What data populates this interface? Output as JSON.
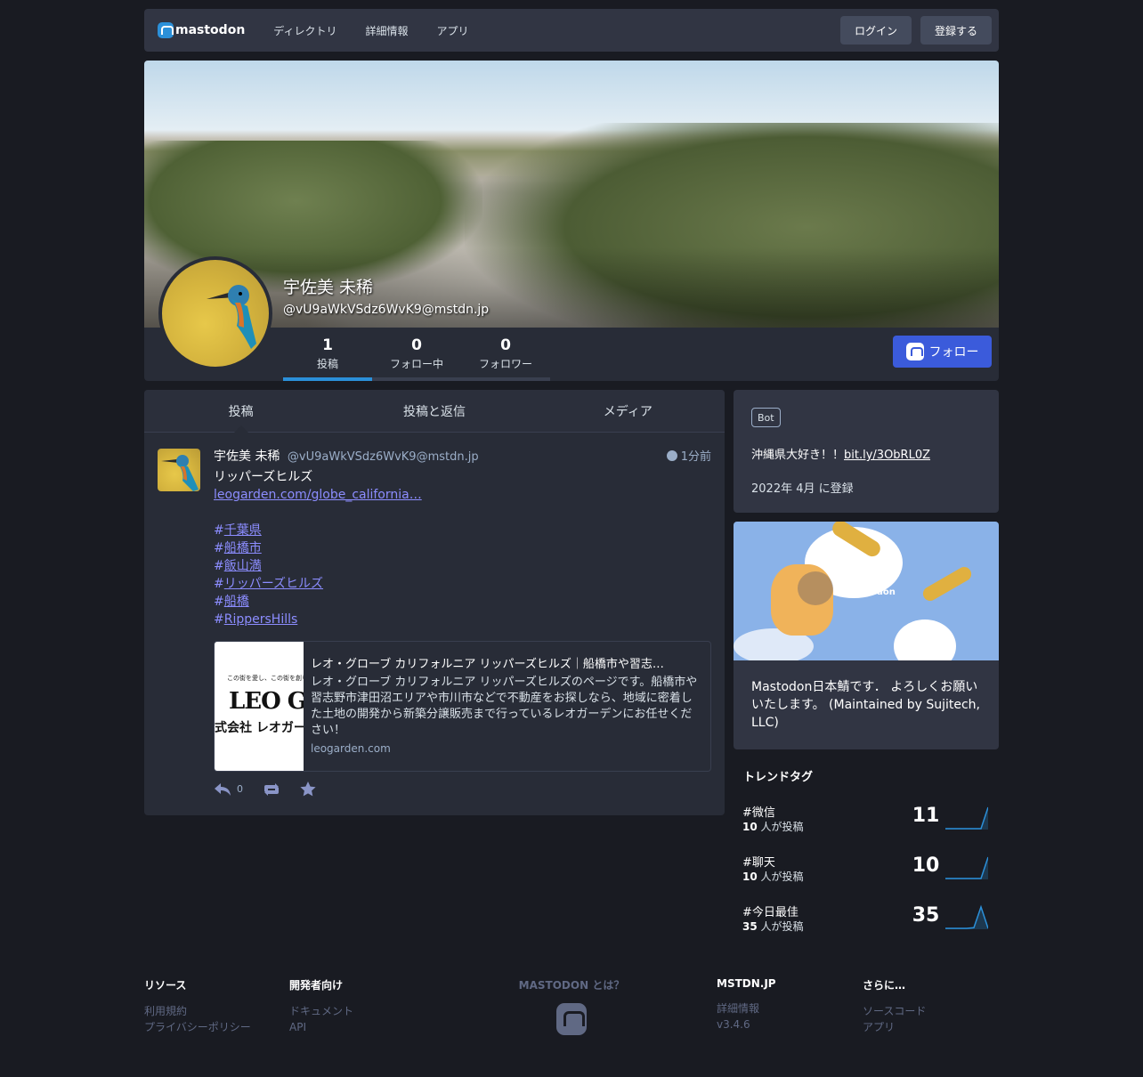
{
  "topbar": {
    "logo": "mastodon",
    "nav": [
      "ディレクトリ",
      "詳細情報",
      "アプリ"
    ],
    "login": "ログイン",
    "register": "登録する"
  },
  "profile": {
    "display_name": "宇佐美 未稀",
    "acct": "@vU9aWkVSdz6WvK9@mstdn.jp",
    "counters": [
      {
        "num": "1",
        "label": "投稿"
      },
      {
        "num": "0",
        "label": "フォロー中"
      },
      {
        "num": "0",
        "label": "フォロワー"
      }
    ],
    "follow": "フォロー"
  },
  "tabs": [
    "投稿",
    "投稿と返信",
    "メディア"
  ],
  "status": {
    "name": "宇佐美 未稀",
    "acct": "@vU9aWkVSdz6WvK9@mstdn.jp",
    "time": "1分前",
    "title": "リッパーズヒルズ",
    "link": "leogarden.com/globe_california…",
    "tags": [
      "千葉県",
      "船橋市",
      "飯山満",
      "リッパーズヒルズ",
      "船橋",
      "RippersHills"
    ],
    "card": {
      "img_line1": "この街を愛し、この街を創り、住",
      "img_logo": "LEO GAR",
      "img_line3": "式会社 レオガーデ",
      "title": "レオ・グローブ カリフォルニア リッパーズヒルズ｜船橋市や習志…",
      "description": "レオ・グローブ カリフォルニア リッパーズヒルズのページです。船橋市や習志野市津田沼エリアや市川市などで不動産をお探しなら、地域に密着した土地の開発から新築分譲販売まで行っているレオガーデンにお任せください！",
      "host": "leogarden.com"
    },
    "reply_count": "0",
    "icons": [
      "reply-icon",
      "boost-icon",
      "favourite-icon"
    ]
  },
  "about": {
    "badge": "Bot",
    "bio_text": "沖縄県大好き！！",
    "bio_link": "bit.ly/3ObRL0Z",
    "joined": "2022年 4月 に登録"
  },
  "hero": {
    "image_logo": "mastodon",
    "description": "Mastodon日本鯖です． よろしくお願いいたします。 (Maintained by Sujitech, LLC)"
  },
  "trends": {
    "title": "トレンドタグ",
    "items": [
      {
        "name": "微信",
        "people": "10",
        "people_suffix": " 人が投稿",
        "uses": "11",
        "history": [
          0,
          0,
          0,
          0,
          0,
          0,
          11
        ]
      },
      {
        "name": "聊天",
        "people": "10",
        "people_suffix": " 人が投稿",
        "uses": "10",
        "history": [
          0,
          0,
          0,
          0,
          0,
          0,
          10
        ]
      },
      {
        "name": "今日最佳",
        "people": "35",
        "people_suffix": " 人が投稿",
        "uses": "35",
        "history": [
          0,
          0,
          0,
          0,
          1,
          35,
          0
        ]
      }
    ]
  },
  "footer": {
    "resources": {
      "title": "リソース",
      "links": [
        "利用規約",
        "プライバシーポリシー"
      ]
    },
    "developers": {
      "title": "開発者向け",
      "links": [
        "ドキュメント",
        "API"
      ]
    },
    "mastodon": {
      "title": "MASTODON とは？"
    },
    "instance": {
      "title": "MSTDN.JP",
      "links": [
        "詳細情報",
        "v3.4.6"
      ]
    },
    "more": {
      "title": "さらに…",
      "links": [
        "ソースコード",
        "アプリ"
      ]
    }
  },
  "colors": {
    "accent": "#3b5bdb",
    "link": "#8c8dff",
    "bg": "#191b22",
    "panel": "#282c37"
  }
}
